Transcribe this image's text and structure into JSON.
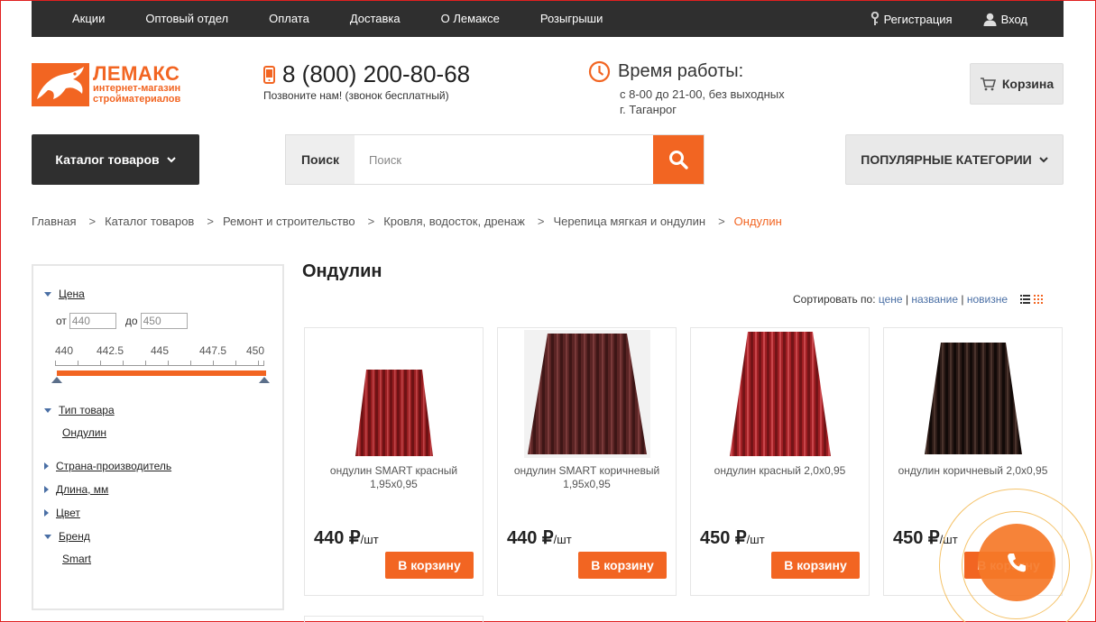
{
  "topnav": {
    "items": [
      "Акции",
      "Оптовый отдел",
      "Оплата",
      "Доставка",
      "О Лемаксе",
      "Розыгрыши"
    ],
    "register": "Регистрация",
    "login": "Вход"
  },
  "logo": {
    "name": "ЛЕМАКС",
    "line1": "интернет-магазин",
    "line2": "стройматериалов"
  },
  "phone": {
    "number": "8 (800) 200-80-68",
    "note": "Позвоните нам! (звонок бесплатный)"
  },
  "hours": {
    "title": "Время работы:",
    "line1": "с 8-00 до 21-00, без выходных",
    "line2": "г. Таганрог"
  },
  "cart": {
    "label": "Корзина"
  },
  "catalog": {
    "label": "Каталог товаров"
  },
  "search": {
    "label": "Поиск",
    "placeholder": "Поиск"
  },
  "popular": {
    "label": "ПОПУЛЯРНЫЕ КАТЕГОРИИ"
  },
  "breadcrumb": [
    "Главная",
    "Каталог товаров",
    "Ремонт и строительство",
    "Кровля, водосток, дренаж",
    "Черепица мягкая и ондулин",
    "Ондулин"
  ],
  "filter": {
    "price": {
      "label": "Цена",
      "from_label": "от",
      "to_label": "до",
      "from": "440",
      "to": "450",
      "ticks": [
        "440",
        "442.5",
        "445",
        "447.5",
        "450"
      ],
      "selected_range": [
        440,
        450
      ]
    },
    "type": {
      "label": "Тип товара",
      "value": "Ондулин"
    },
    "country": {
      "label": "Страна-производитель"
    },
    "length": {
      "label": "Длина, мм"
    },
    "color": {
      "label": "Цвет"
    },
    "brand": {
      "label": "Бренд",
      "value": "Smart"
    }
  },
  "main": {
    "title": "Ондулин"
  },
  "sort": {
    "label": "Сортировать по:",
    "options": [
      "цене",
      "название",
      "новизне"
    ],
    "sep": "|"
  },
  "products": [
    {
      "name": "ондулин SMART красный 1,95х0,95",
      "price": "440 ₽",
      "unit": "/шт",
      "button": "В корзину",
      "color": "#9a1f22"
    },
    {
      "name": "ондулин SMART коричневый 1,95х0,95",
      "price": "440 ₽",
      "unit": "/шт",
      "button": "В корзину",
      "color": "#5a2424"
    },
    {
      "name": "ондулин красный 2,0х0,95",
      "price": "450 ₽",
      "unit": "/шт",
      "button": "В корзину",
      "color": "#a11f24"
    },
    {
      "name": "ондулин коричневый 2,0х0,95",
      "price": "450 ₽",
      "unit": "/шт",
      "button": "В корзину",
      "color": "#2b1a16"
    }
  ],
  "colors": {
    "accent": "#f26522",
    "dark": "#2f2f2f"
  },
  "icons": [
    "key-icon",
    "user-icon",
    "phone-icon",
    "clock-icon",
    "cart-icon",
    "chevron-down-icon",
    "search-icon",
    "list-view-icon",
    "grid-view-icon",
    "handset-icon"
  ]
}
